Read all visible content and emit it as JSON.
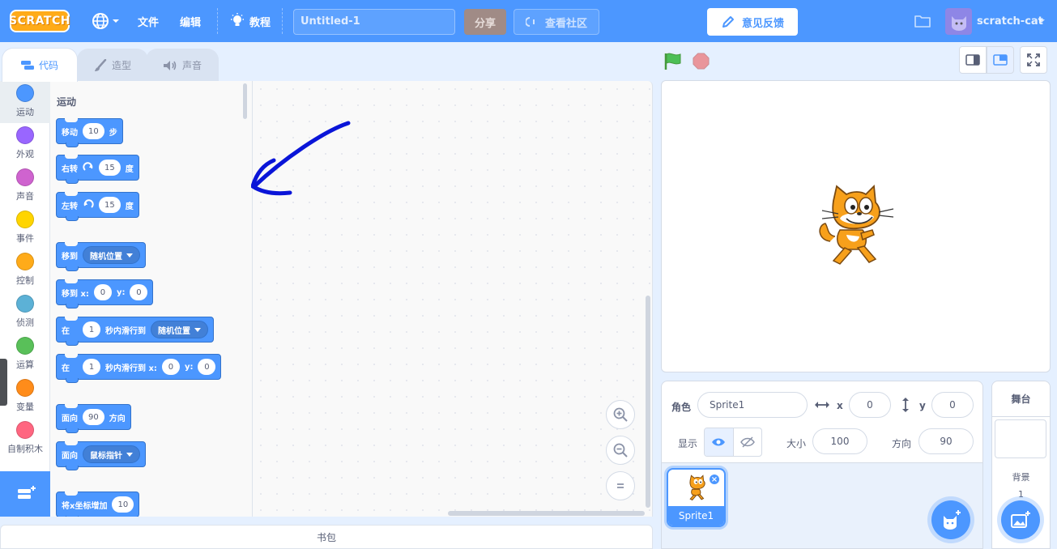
{
  "menubar": {
    "logo": "SCRATCH",
    "file": "文件",
    "edit": "编辑",
    "tutorials": "教程",
    "project_title": "Untitled-1",
    "share": "分享",
    "see_community": "查看社区",
    "feedback": "意见反馈",
    "username": "scratch-cat"
  },
  "tabs": [
    {
      "label": "代码",
      "icon": "code-icon"
    },
    {
      "label": "造型",
      "icon": "brush-icon"
    },
    {
      "label": "声音",
      "icon": "speaker-icon"
    }
  ],
  "categories": [
    {
      "label": "运动",
      "color": "#4c97ff"
    },
    {
      "label": "外观",
      "color": "#9966ff"
    },
    {
      "label": "声音",
      "color": "#cf63cf"
    },
    {
      "label": "事件",
      "color": "#ffd500"
    },
    {
      "label": "控制",
      "color": "#ffab19"
    },
    {
      "label": "侦测",
      "color": "#5cb1d6"
    },
    {
      "label": "运算",
      "color": "#59c059"
    },
    {
      "label": "变量",
      "color": "#ff8c1a"
    },
    {
      "label": "自制积木",
      "color": "#ff6680"
    }
  ],
  "palette": {
    "title": "运动",
    "blocks": {
      "move": {
        "label": "移动",
        "value": "10",
        "suffix": "步"
      },
      "turn_right": {
        "label": "右转",
        "value": "15",
        "suffix": "度"
      },
      "turn_left": {
        "label": "左转",
        "value": "15",
        "suffix": "度"
      },
      "goto": {
        "label": "移到",
        "option": "随机位置"
      },
      "goto_xy": {
        "label": "移到 x:",
        "x": "0",
        "ylabel": "y:",
        "y": "0"
      },
      "glide": {
        "label": "在",
        "value": "1",
        "middle": "秒内滑行到",
        "option": "随机位置"
      },
      "glide_xy": {
        "label": "在",
        "value": "1",
        "middle": "秒内滑行到 x:",
        "x": "0",
        "ylabel": "y:",
        "y": "0"
      },
      "point_dir": {
        "label": "面向",
        "value": "90",
        "suffix": "方向"
      },
      "point_towards": {
        "label": "面向",
        "option": "鼠标指针"
      },
      "change_x": {
        "label": "将x坐标增加",
        "value": "10"
      }
    }
  },
  "backpack": "书包",
  "sprite_info": {
    "sprite_label": "角色",
    "sprite_name": "Sprite1",
    "x_label": "x",
    "x": "0",
    "y_label": "y",
    "y": "0",
    "show_label": "显示",
    "size_label": "大小",
    "size": "100",
    "direction_label": "方向",
    "direction": "90"
  },
  "sprites": [
    {
      "name": "Sprite1"
    }
  ],
  "stage_panel": {
    "title": "舞台",
    "backdrops_label": "背景",
    "backdrops_count": "1"
  },
  "colors": {
    "accent": "#4c97ff",
    "motion": "#4c97ff",
    "background": "#e5f0ff"
  }
}
